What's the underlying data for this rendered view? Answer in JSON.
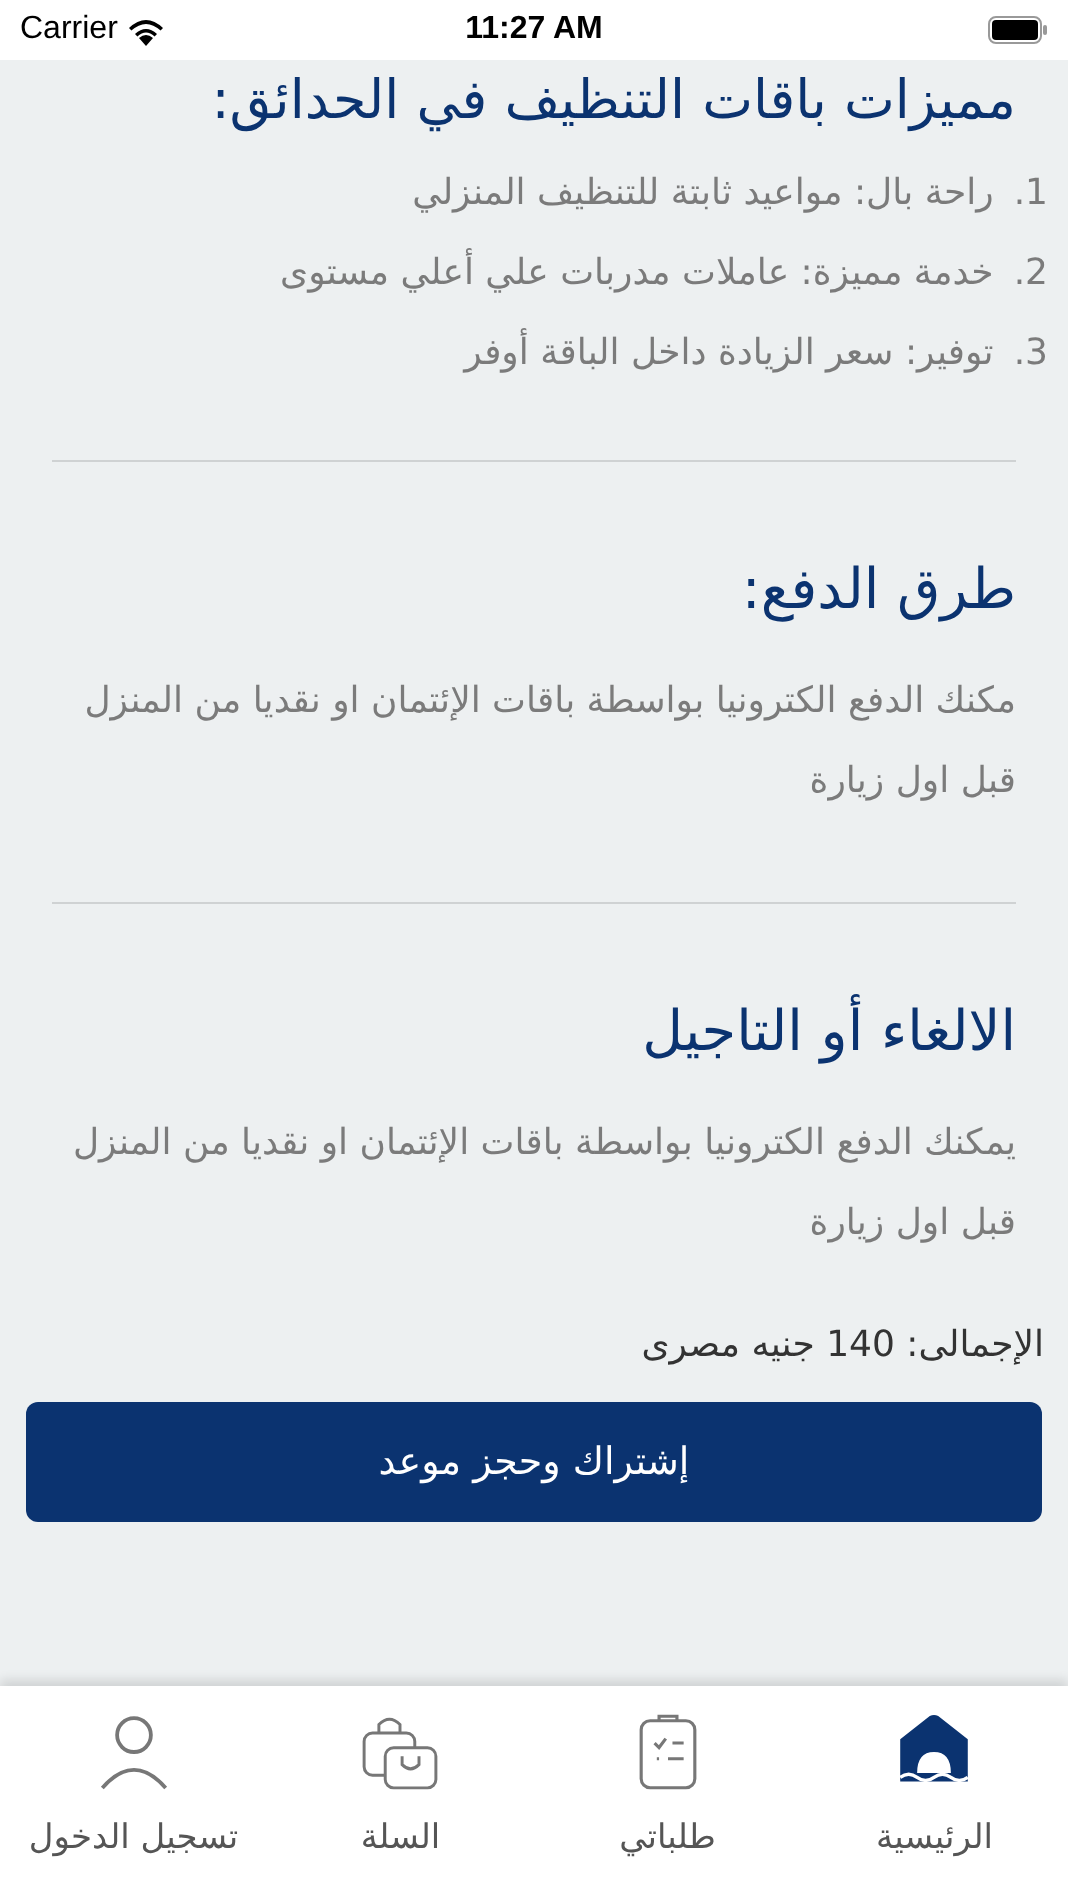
{
  "status_bar": {
    "carrier": "Carrier",
    "time": "11:27 AM"
  },
  "features_heading": "مميزات باقات التنظيف في الحدائق:",
  "features": [
    {
      "number": "1.",
      "text": "راحة بال: مواعيد ثابتة للتنظيف المنزلي"
    },
    {
      "number": "2.",
      "text": "خدمة مميزة: عاملات مدربات علي أعلي مستوى"
    },
    {
      "number": "3.",
      "text": "توفير: سعر الزيادة داخل الباقة أوفر"
    }
  ],
  "sections": [
    {
      "heading": "طرق الدفع:",
      "body": "مكنك الدفع الكترونيا بواسطة باقات الإئتمان او نقديا من المنزل قبل اول زيارة"
    },
    {
      "heading": "الالغاء أو التاجيل",
      "body": "يمكنك الدفع الكترونيا بواسطة باقات الإئتمان او نقديا من المنزل قبل اول زيارة"
    }
  ],
  "total": "الإجمالى: 140 جنيه مصرى",
  "subscribe_button": "إشتراك وحجز موعد",
  "tabs": [
    {
      "kind": "home",
      "label": "الرئيسية",
      "selected": true
    },
    {
      "kind": "orders",
      "label": "طلباتي",
      "selected": false
    },
    {
      "kind": "cart",
      "label": "السلة",
      "selected": false
    },
    {
      "kind": "login",
      "label": "تسجيل الدخول",
      "selected": false
    }
  ]
}
